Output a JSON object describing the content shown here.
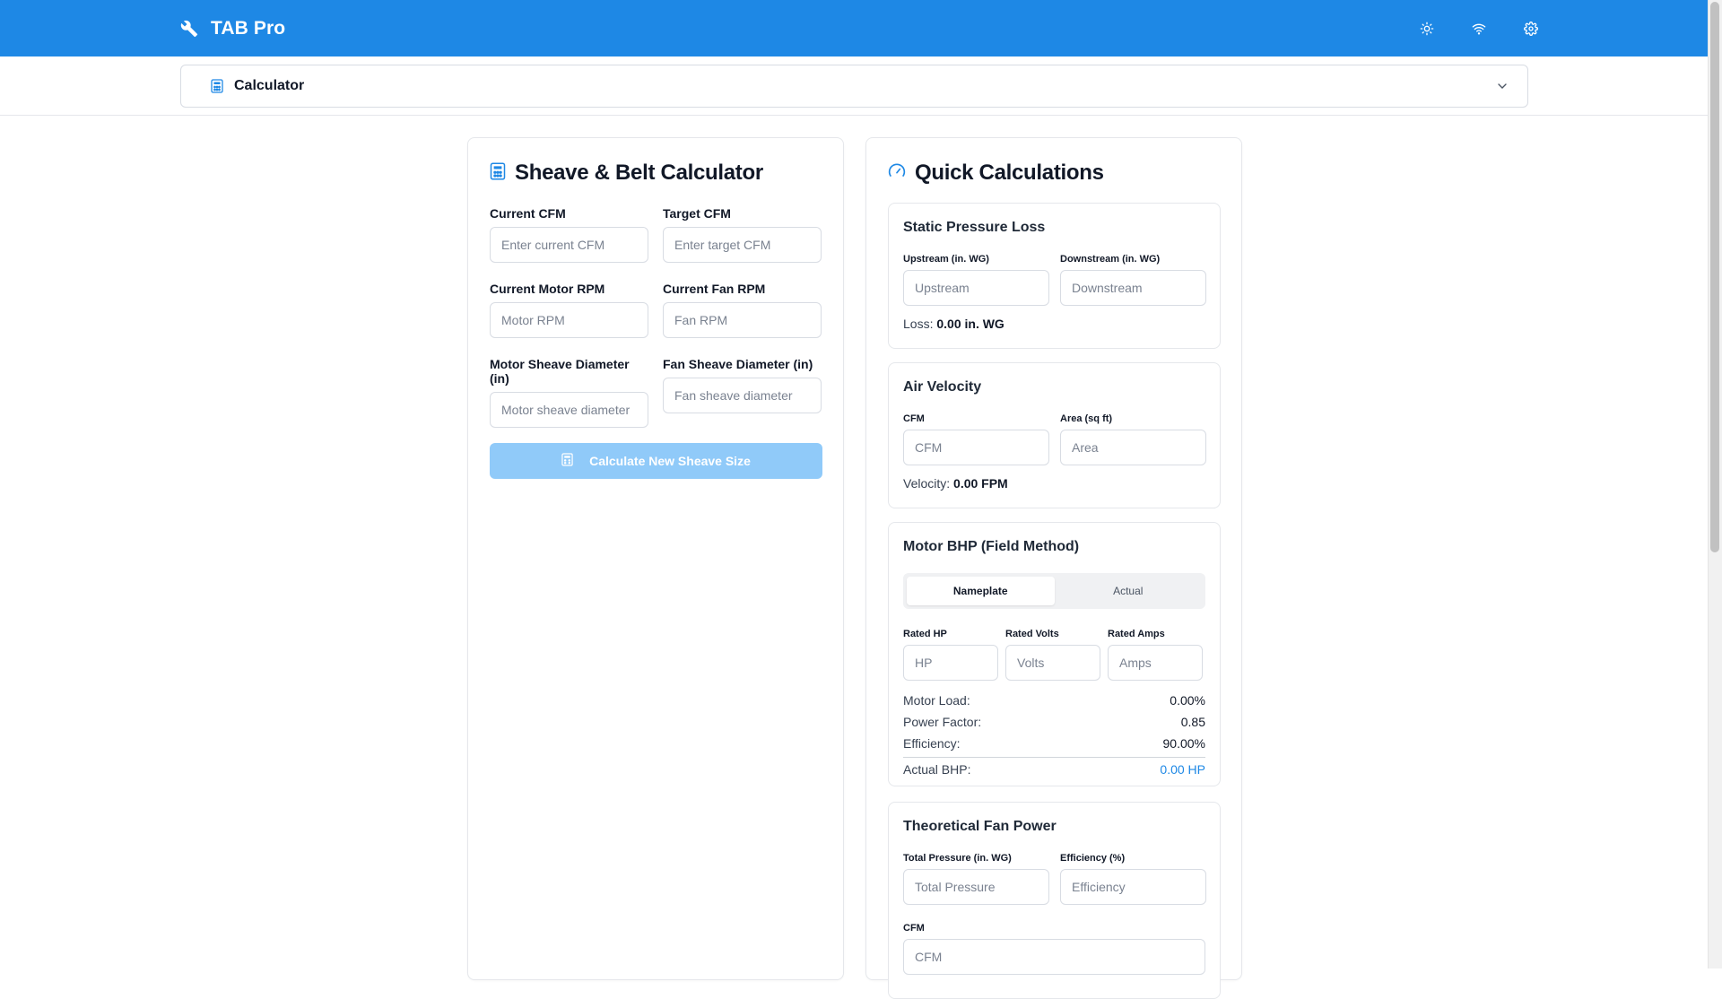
{
  "app": {
    "title": "TAB Pro"
  },
  "header": {
    "actions": [
      {
        "name": "theme-toggle",
        "icon": "sun-icon"
      },
      {
        "name": "connection-status",
        "icon": "wifi-icon"
      },
      {
        "name": "settings",
        "icon": "gear-icon"
      }
    ]
  },
  "nav": {
    "selected": "Calculator",
    "icon": "calculator-icon"
  },
  "sheave": {
    "title": "Sheave & Belt Calculator",
    "fields": {
      "current_cfm": {
        "label": "Current CFM",
        "placeholder": "Enter current CFM"
      },
      "target_cfm": {
        "label": "Target CFM",
        "placeholder": "Enter target CFM"
      },
      "motor_rpm": {
        "label": "Current Motor RPM",
        "placeholder": "Motor RPM"
      },
      "fan_rpm": {
        "label": "Current Fan RPM",
        "placeholder": "Fan RPM"
      },
      "motor_sheave": {
        "label": "Motor Sheave Diameter (in)",
        "placeholder": "Motor sheave diameter"
      },
      "fan_sheave": {
        "label": "Fan Sheave Diameter (in)",
        "placeholder": "Fan sheave diameter"
      }
    },
    "button_label": "Calculate New Sheave Size"
  },
  "quick": {
    "title": "Quick Calculations",
    "static_pressure": {
      "title": "Static Pressure Loss",
      "upstream": {
        "label": "Upstream (in. WG)",
        "placeholder": "Upstream"
      },
      "downstream": {
        "label": "Downstream (in. WG)",
        "placeholder": "Downstream"
      },
      "result_label": "Loss:",
      "result_value": "0.00 in. WG"
    },
    "air_velocity": {
      "title": "Air Velocity",
      "cfm": {
        "label": "CFM",
        "placeholder": "CFM"
      },
      "area": {
        "label": "Area (sq ft)",
        "placeholder": "Area"
      },
      "result_label": "Velocity:",
      "result_value": "0.00 FPM"
    },
    "motor_bhp": {
      "title": "Motor BHP (Field Method)",
      "tabs": [
        "Nameplate",
        "Actual"
      ],
      "active_tab": "Nameplate",
      "rated_hp": {
        "label": "Rated HP",
        "placeholder": "HP"
      },
      "rated_volts": {
        "label": "Rated Volts",
        "placeholder": "Volts"
      },
      "rated_amps": {
        "label": "Rated Amps",
        "placeholder": "Amps"
      },
      "stats": [
        {
          "label": "Motor Load:",
          "value": "0.00%"
        },
        {
          "label": "Power Factor:",
          "value": "0.85"
        },
        {
          "label": "Efficiency:",
          "value": "90.00%"
        }
      ],
      "actual_label": "Actual BHP:",
      "actual_value": "0.00 HP",
      "accent_color": "#1e88e5"
    },
    "fan_power": {
      "title": "Theoretical Fan Power",
      "total_pressure": {
        "label": "Total Pressure (in. WG)",
        "placeholder": "Total Pressure"
      },
      "efficiency": {
        "label": "Efficiency (%)",
        "placeholder": "Efficiency"
      },
      "cfm": {
        "label": "CFM",
        "placeholder": "CFM"
      }
    }
  },
  "colors": {
    "primary": "#1e88e5",
    "button_disabled": "#90caf9"
  }
}
